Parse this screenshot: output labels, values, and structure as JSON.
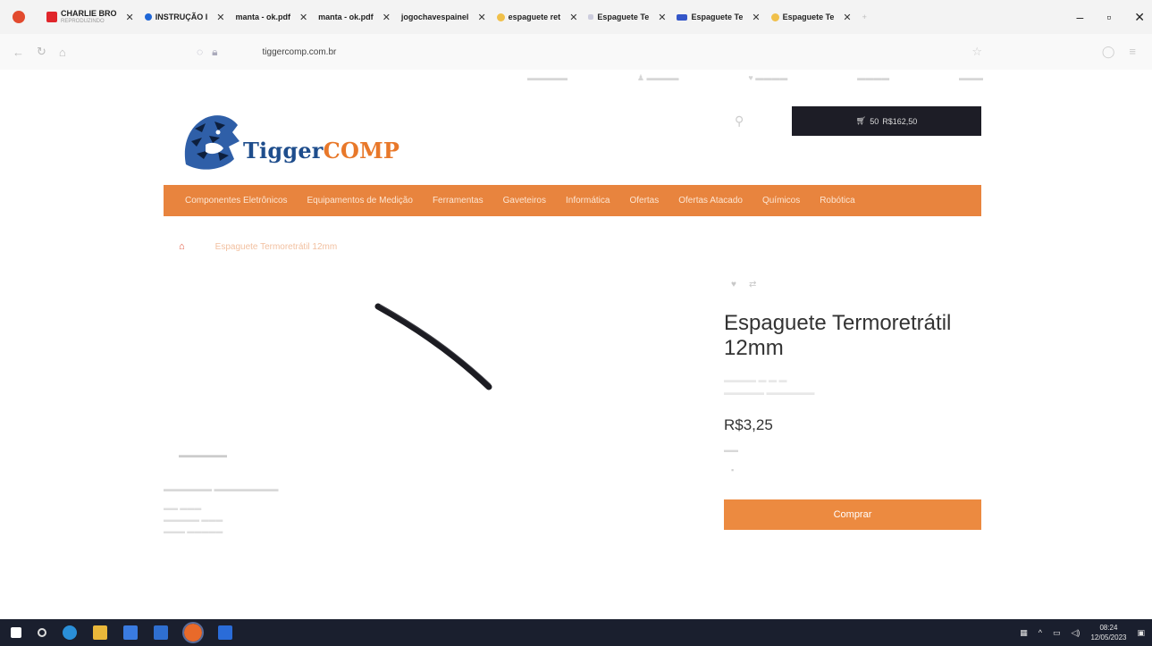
{
  "browser": {
    "tabs": [
      {
        "label": "CHARLIE BRO",
        "sub": "REPRODUZINDO",
        "favicon_color": "#e0262b"
      },
      {
        "label": "INSTRUÇÃO I",
        "favicon_color": "#1f66d6"
      },
      {
        "label": "manta - ok.pdf",
        "favicon_color": ""
      },
      {
        "label": "manta - ok.pdf",
        "favicon_color": ""
      },
      {
        "label": "jogochavespainel",
        "favicon_color": ""
      },
      {
        "label": "espaguete ret",
        "favicon_color": "#f0c04a"
      },
      {
        "label": "Espaguete Te",
        "favicon_color": "#88c"
      },
      {
        "label": "Espaguete Te",
        "favicon_color": "#3456c8"
      },
      {
        "label": "Espaguete Te",
        "favicon_color": "#f0c04a"
      }
    ],
    "url": "tiggercomp.com.br",
    "window_controls": {
      "minimize": "–",
      "maximize": "▫",
      "close": "✕"
    }
  },
  "site": {
    "logo": {
      "part1": "Tigger",
      "part2": "COMP"
    },
    "cart": {
      "count": "50",
      "total": "R$162,50"
    },
    "categories": [
      "Componentes Eletrônicos",
      "Equipamentos de Medição",
      "Ferramentas",
      "Gaveteiros",
      "Informática",
      "Ofertas",
      "Ofertas Atacado",
      "Químicos",
      "Robótica"
    ],
    "breadcrumb": {
      "current": "Espaguete Termoretrátil 12mm"
    }
  },
  "product": {
    "title": "Espaguete Termoretrátil 12mm",
    "price": "R$3,25",
    "buy_label": "Comprar"
  },
  "taskbar": {
    "time": "08:24",
    "date": "12/05/2023"
  },
  "colors": {
    "brand_blue": "#1e4d8c",
    "brand_orange": "#e8782a",
    "menu_orange": "#e8843e",
    "button_orange": "#ec8a40",
    "cart_dark": "#1d1d26",
    "taskbar": "#1a1f2e"
  }
}
